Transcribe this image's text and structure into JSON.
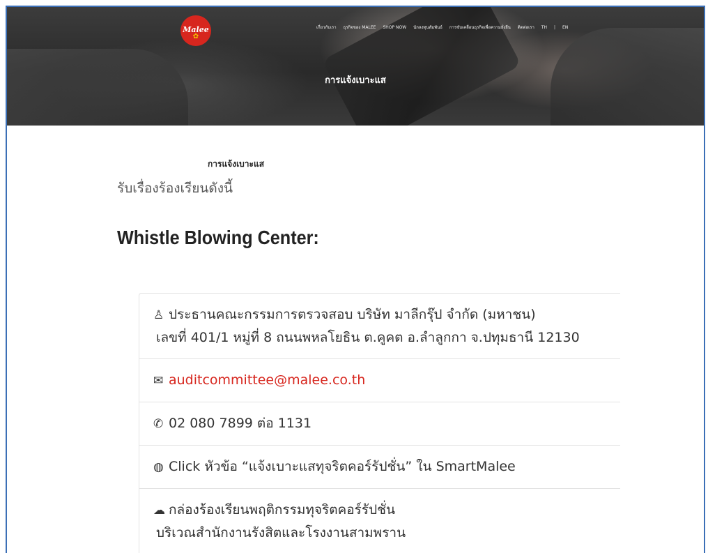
{
  "brand": {
    "logo_text": "Malee",
    "accent": "#d7261e",
    "leaf_color": "#f2c300"
  },
  "nav": {
    "items": [
      "เกี่ยวกับเรา",
      "ธุรกิจของ MALEE",
      "SHOP NOW",
      "นักลงทุนสัมพันธ์",
      "การขับเคลื่อนธุรกิจเพื่อความยั่งยืน",
      "ติดต่อเรา"
    ],
    "lang_th": "TH",
    "lang_sep": "|",
    "lang_en": "EN"
  },
  "hero": {
    "title": "การแจ้งเบาะแส"
  },
  "content": {
    "sub_title": "การแจ้งเบาะแส",
    "intro": "รับเรื่องร้องเรียนดังนี้",
    "heading": "Whistle Blowing Center:",
    "items": [
      {
        "icon": "user-icon",
        "line1": "ประธานคณะกรรมการตรวจสอบ บริษัท มาลีกรุ๊ป จำกัด (มหาชน)",
        "line2": "เลขที่ 401/1 หมู่ที่ 8 ถนนพหลโยธิน ต.คูคต อ.ลำลูกกา จ.ปทุมธานี 12130"
      },
      {
        "icon": "envelope-icon",
        "email": "auditcommittee@malee.co.th"
      },
      {
        "icon": "phone-icon",
        "line1": "02 080 7899 ต่อ 1131"
      },
      {
        "icon": "globe-icon",
        "line1": "Click หัวข้อ “แจ้งเบาะแสทุจริตคอร์รัปชั่น” ใน SmartMalee"
      },
      {
        "icon": "comments-icon",
        "line1": "กล่องร้องเรียนพฤติกรรมทุจริตคอร์รัปชั่น",
        "line2": "บริเวณสำนักงานรังสิตและโรงงานสามพราน"
      }
    ]
  }
}
